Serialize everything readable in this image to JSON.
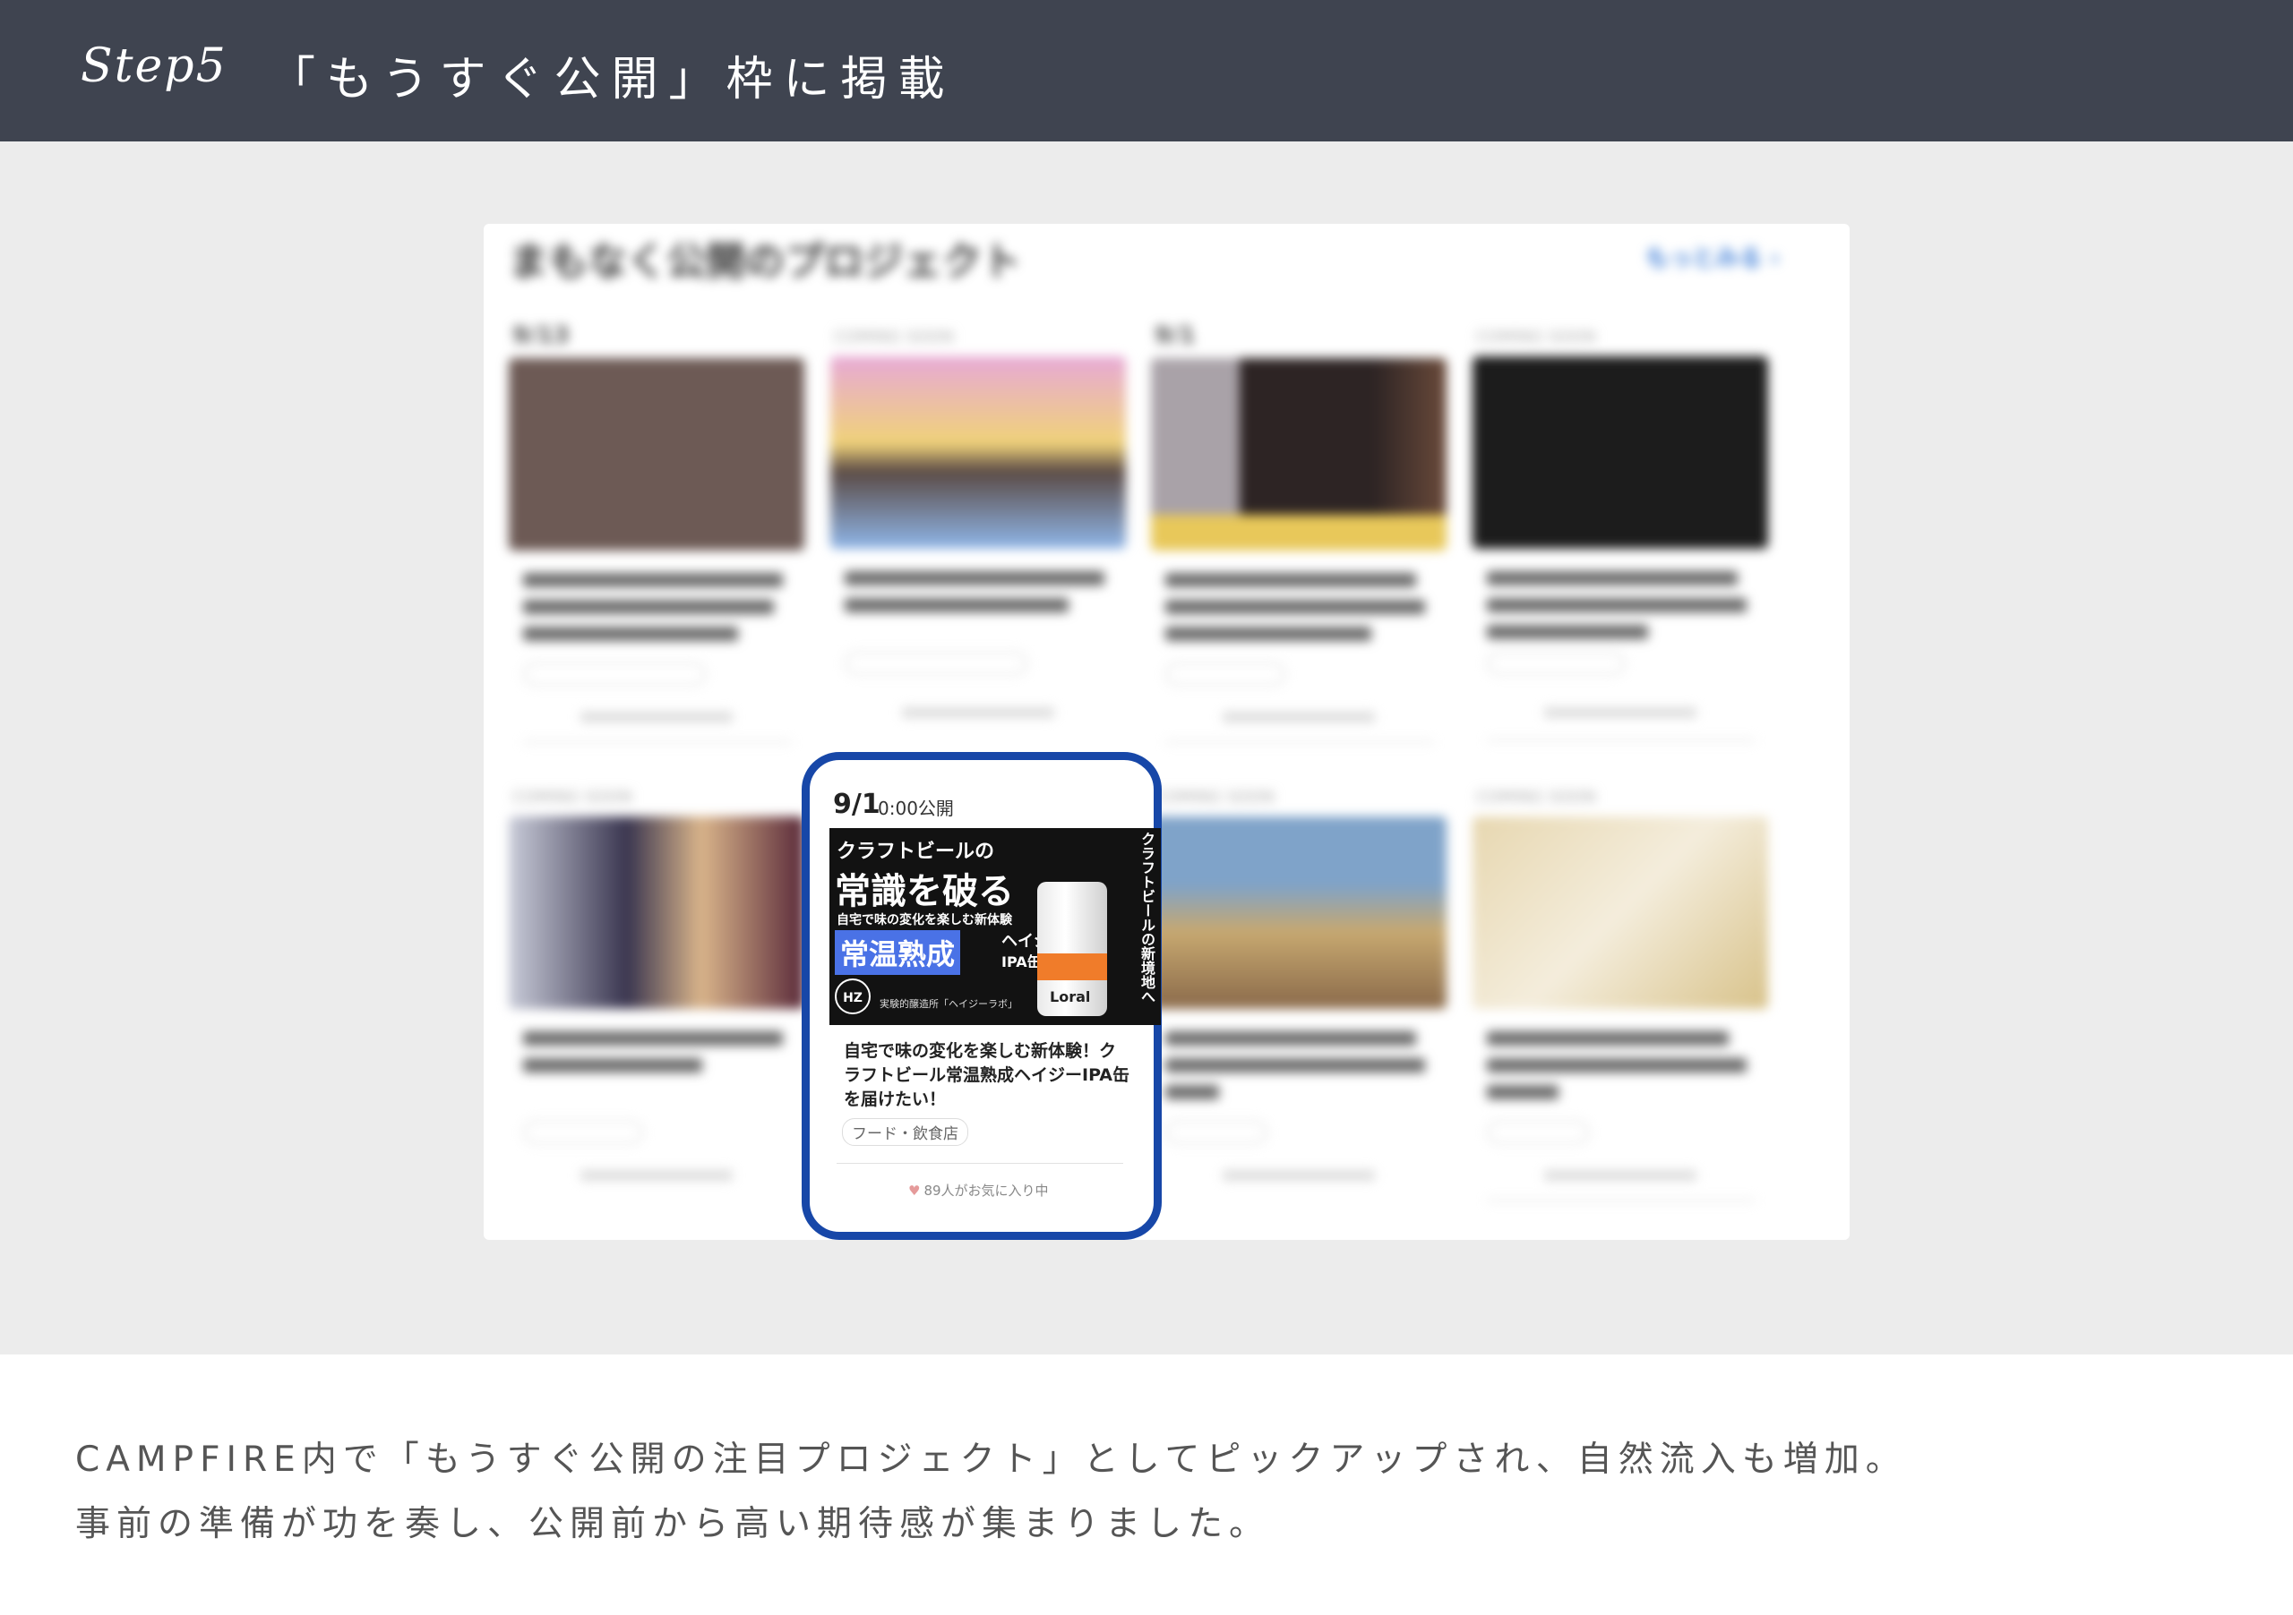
{
  "header": {
    "step_label": "Step5",
    "title": "「もうすぐ公開」枠に掲載"
  },
  "screenshot": {
    "section_title": "まもなく公開のプロジェクト",
    "more_link": "もっとみる ›",
    "blurred_cards": [
      {
        "date": "9/13",
        "image_color": "#6d5a55"
      },
      {
        "date": "COMING SOON",
        "image_color": "#d9a6c8"
      },
      {
        "date": "9/1",
        "image_color": "#4a3a3a"
      },
      {
        "date": "COMING SOON",
        "image_color": "#1c1c1c"
      },
      {
        "date": "COMING SOON",
        "image_color": "#3a3650"
      },
      {
        "date": "COMING SOON",
        "image_color": "#7fa3c9"
      },
      {
        "date": "COMING SOON",
        "image_color": "#e7d7b0"
      }
    ]
  },
  "highlight_card": {
    "date": "9/1",
    "time": "0:00公開",
    "thumbnail": {
      "line1": "クラフトビールの",
      "line2": "常識を破る",
      "line3": "自宅で味の変化を楽しむ新体験",
      "badge": "常温熟成",
      "sub1": "ヘイジー",
      "sub2": "IPA缶",
      "logo": "HZ",
      "small": "実験的醸造所「ヘイジーラボ」",
      "can_label": "Loral",
      "vertical": "クラフトビールの新境地へ"
    },
    "title": "自宅で味の変化を楽しむ新体験！クラフトビール常温熟成ヘイジーIPA缶を届けたい！",
    "category": "フード・飲食店",
    "favorites": "89人がお気に入り中",
    "border_color": "#1747a8"
  },
  "caption": {
    "line1": "CAMPFIRE内で「もうすぐ公開の注目プロジェクト」としてピックアップされ、自然流入も増加。",
    "line2": "事前の準備が功を奏し、公開前から高い期待感が集まりました。"
  }
}
